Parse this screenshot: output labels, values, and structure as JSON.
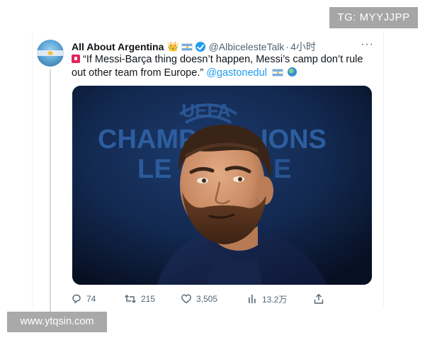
{
  "overlay": {
    "tg_label": "TG: MYYJJPP",
    "watermark": "www.ytqsin.com"
  },
  "tweet": {
    "author_name": "All About Argentina",
    "name_emoji": "👑",
    "handle": "@AlbicelesteTalk",
    "separator": "·",
    "time": "4小时",
    "more_label": "···",
    "text_main": "“If Messi-Barça thing doesn’t happen, Messi’s camp don’t rule out other team from Europe.”",
    "mention": "@gastonedul",
    "image": {
      "subject": "Lionel Messi at a press conference",
      "backdrop_lines": [
        "UEFA",
        "CHAMPIONS",
        "LEAGUE"
      ],
      "backdrop_visible": [
        "UEFA",
        "CHAMP",
        "IONS",
        "LE",
        "E"
      ]
    },
    "actions": {
      "replies": "74",
      "retweets": "215",
      "likes": "3,505",
      "views": "13.2万"
    },
    "colors": {
      "accent": "#1d9bf0",
      "secondary_text": "#536471",
      "primary_text": "#0f1419"
    }
  }
}
